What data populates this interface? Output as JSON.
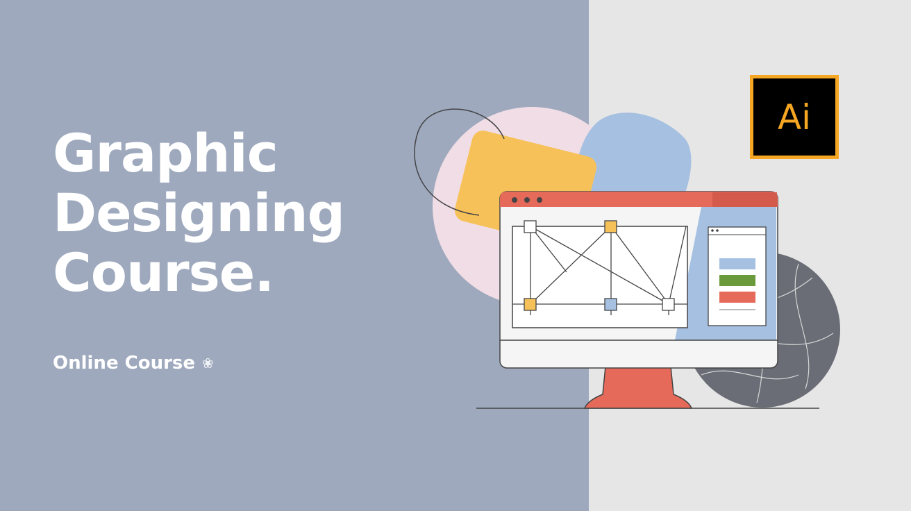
{
  "hero": {
    "title_lines": [
      "Graphic",
      "Designing",
      "Course."
    ],
    "subtitle": "Online Course"
  },
  "logo": {
    "text": "Ai"
  },
  "icons": {
    "subtitle_icon": "sparkle-icon",
    "logo_icon": "adobe-illustrator-icon",
    "window_controls": "window-dots-icon"
  },
  "colors": {
    "left_background": "#9ea9be",
    "right_background": "#e6e6e6",
    "title_text": "#ffffff",
    "accent_yellow": "#f7c159",
    "accent_blue": "#a6c0e2",
    "accent_pink": "#f1dde6",
    "accent_red": "#e66a5a",
    "accent_green": "#6a9a3a",
    "dark_circle": "#6a6d76",
    "logo_orange": "#f5a623",
    "logo_background": "#000000"
  }
}
